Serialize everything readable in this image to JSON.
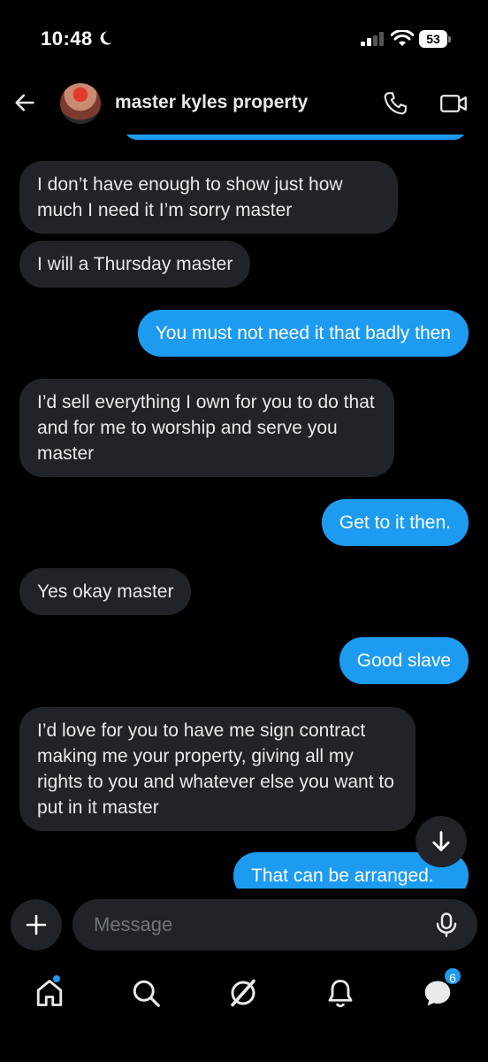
{
  "status_bar": {
    "time": "10:48",
    "battery": "53",
    "icons": [
      "moon-icon",
      "signal-icon",
      "wifi-icon",
      "battery-icon"
    ]
  },
  "header": {
    "contact_name": "master kyles property",
    "icons": [
      "back-arrow-icon",
      "phone-icon",
      "video-camera-icon"
    ]
  },
  "messages": [
    {
      "side": "in",
      "text": "I don’t have enough to show just how much I need it I’m sorry master"
    },
    {
      "side": "in",
      "text": "I will a Thursday master"
    },
    {
      "side": "out",
      "text": "You must not need it that badly then"
    },
    {
      "side": "in",
      "text": "I’d sell everything I own for you to do that and for me to worship and serve you master"
    },
    {
      "side": "out",
      "text": "Get to it then."
    },
    {
      "side": "in",
      "text": "Yes okay master"
    },
    {
      "side": "out",
      "text": "Good slave"
    },
    {
      "side": "in",
      "text": "I’d love for you to have me sign contract making me your property, giving all my rights to you and whatever else you want to put in it master"
    },
    {
      "side": "out",
      "text": "That can be arranged."
    }
  ],
  "composer": {
    "placeholder": "Message"
  },
  "nav": {
    "items": [
      "home-icon",
      "search-icon",
      "grok-icon",
      "notifications-icon",
      "messages-icon"
    ],
    "messages_badge": "6"
  },
  "colors": {
    "background": "#000000",
    "incoming_bubble": "#202327",
    "outgoing_bubble": "#1d9bf0",
    "accent": "#1d9bf0"
  }
}
